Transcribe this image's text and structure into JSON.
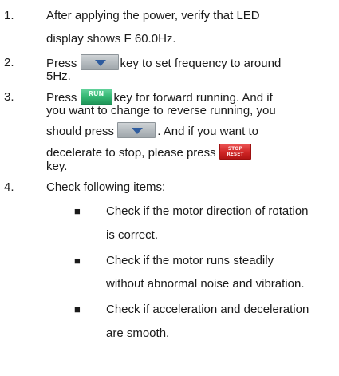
{
  "steps": [
    {
      "number": "1.",
      "line1": "After applying the power, verify that LED",
      "line2": "display shows F 60.0Hz."
    },
    {
      "number": "2.",
      "before_key": "Press",
      "after_key": "key to set frequency to around",
      "line2": "5Hz."
    },
    {
      "number": "3.",
      "before_key": "Press",
      "after_key": "key for forward running. And if",
      "line2": "you want to change to reverse running, you",
      "line3_before_key": "should press",
      "line3_after_key": ". And if you want to",
      "line4_before_key": "decelerate to stop, please press",
      "line5": "key."
    },
    {
      "number": "4.",
      "line1": "Check following items:"
    }
  ],
  "checks": [
    {
      "bullet": "■",
      "line1": "Check if the motor direction of rotation",
      "line2": "is correct."
    },
    {
      "bullet": "■",
      "line1": "Check if the motor runs steadily",
      "line2": "without abnormal noise and vibration."
    },
    {
      "bullet": "■",
      "line1": "Check if acceleration and deceleration",
      "line2": "are smooth."
    }
  ],
  "keys": {
    "run_label": "RUN",
    "stop_label_top": "STOP",
    "stop_label_bottom": "RESET",
    "down_icon": "down-arrow-key-icon"
  },
  "colors": {
    "run_key": "#35b874",
    "stop_key": "#cf2525",
    "down_key": "#b8bec2",
    "down_arrow": "#2f5c9e"
  }
}
